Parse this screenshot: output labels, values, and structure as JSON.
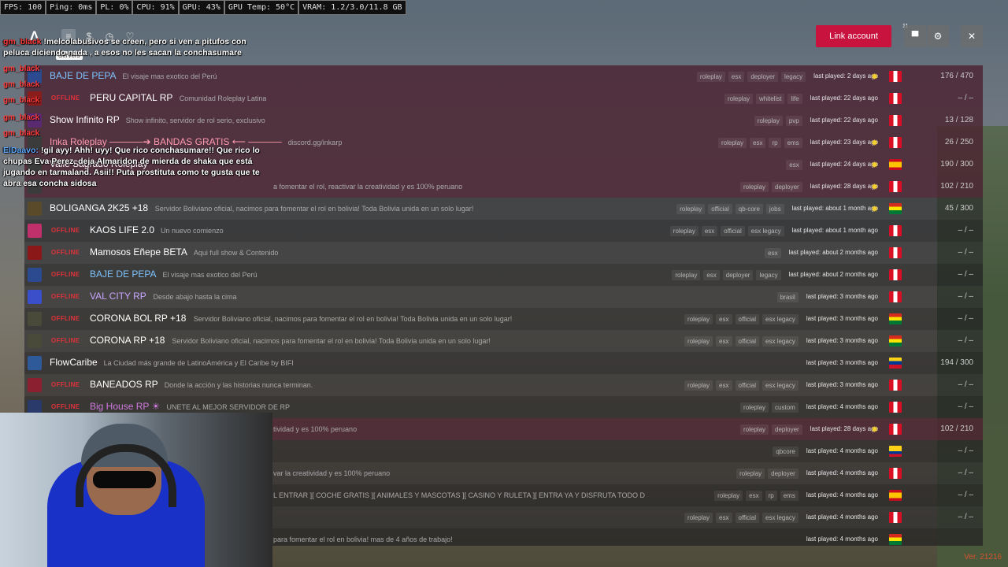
{
  "perf": [
    "FPS: 100",
    "Ping: 0ms",
    "PL: 0%",
    "CPU: 91%",
    "GPU: 43%",
    "GPU Temp: 50°C",
    "VRAM: 1.2/3.0/11.8 GB"
  ],
  "topbar": {
    "logo": "Λ",
    "nav_icons": [
      {
        "name": "servers-list-icon",
        "glyph": "≡",
        "active": true
      },
      {
        "name": "dollar-icon",
        "glyph": "$",
        "active": false
      },
      {
        "name": "history-icon",
        "glyph": "◷",
        "active": false
      },
      {
        "name": "favorites-heart-icon",
        "glyph": "♡",
        "active": false
      }
    ],
    "tooltip": "Servers",
    "link_account": "Link account",
    "badge_count": "11",
    "close_glyph": "✕",
    "settings_glyph": "⚙",
    "tools_glyph": "▀"
  },
  "servers": [
    {
      "icon_color": "#2b4a8f",
      "offline": "",
      "name": "BAJE DE PEPA",
      "name_color": "#7ec3ff",
      "desc": "El visaje mas exotico del Perú",
      "tags": [
        "roleplay",
        "esx",
        "deployer",
        "legacy"
      ],
      "last": "last played: 2 days ago",
      "sun": true,
      "flag": "pe",
      "players": "176 / 470",
      "pinned": true
    },
    {
      "icon_color": "#8a1c1c",
      "offline": "OFFLINE",
      "name": "PERU CAPITAL RP",
      "name_color": "#ffffff",
      "desc": "Comunidad Roleplay Latina",
      "tags": [
        "roleplay",
        "whitelist",
        "life"
      ],
      "last": "last played: 22 days ago",
      "sun": false,
      "flag": "pe",
      "players": "– / –",
      "pinned": true
    },
    {
      "icon_color": "#5a2a70",
      "offline": "",
      "name": "Show Infinito RP",
      "name_color": "#ffffff",
      "desc": "Show infinito, servidor de rol serio, exclusivo",
      "tags": [
        "roleplay",
        "pvp"
      ],
      "last": "last played: 22 days ago",
      "sun": false,
      "flag": "pe",
      "players": "13 / 128",
      "pinned": true
    },
    {
      "icon_color": "#3b3b3b",
      "offline": "",
      "name": "Inka Roleplay ─────➔ BANDAS GRATIS ⟵ ─────",
      "name_color": "#ff9ab0",
      "desc": "discord.gg/inkarp",
      "tags": [
        "roleplay",
        "esx",
        "rp",
        "ems"
      ],
      "last": "last played: 23 days ago",
      "sun": true,
      "flag": "pe",
      "players": "26 / 250",
      "pinned": true
    },
    {
      "icon_color": "#3b3b3b",
      "offline": "",
      "name": "Valle Sagrado Roleplay",
      "name_color": "#ffffff",
      "desc": "",
      "tags": [
        "esx"
      ],
      "last": "last played: 24 days ago",
      "sun": true,
      "flag": "es",
      "players": "190 / 300",
      "pinned": true
    },
    {
      "icon_color": "#3b3b3b",
      "offline": "",
      "name": "",
      "name_color": "#ffffff",
      "desc": "a fomentar el rol, reactivar la creatividad y es 100% peruano",
      "tags": [
        "roleplay",
        "deployer"
      ],
      "last": "last played: 28 days ago",
      "sun": true,
      "flag": "pe",
      "players": "102 / 210",
      "pinned": true
    },
    {
      "icon_color": "#5a4a2a",
      "offline": "",
      "name": "BOLIGANGA 2K25 +18",
      "name_color": "#ffffff",
      "desc": "Servidor Boliviano oficial, nacimos para fomentar el rol en bolivia! Toda Bolivia unida en un solo lugar!",
      "tags": [
        "roleplay",
        "official",
        "qb-core",
        "jobs"
      ],
      "last": "last played: about 1 month ago",
      "sun": true,
      "flag": "bo",
      "players": "45 / 300",
      "pinned": false
    },
    {
      "icon_color": "#c0306a",
      "offline": "OFFLINE",
      "name": "KAOS LIFE 2.0",
      "name_color": "#ffffff",
      "desc": "Un nuevo comienzo",
      "tags": [
        "roleplay",
        "esx",
        "official",
        "esx legacy"
      ],
      "last": "last played: about 1 month ago",
      "sun": false,
      "flag": "pe",
      "players": "– / –",
      "pinned": false
    },
    {
      "icon_color": "#8a1818",
      "offline": "OFFLINE",
      "name": "Mamosos Eñepe BETA",
      "name_color": "#ffffff",
      "desc": "Aqui full show & Contenido",
      "tags": [
        "esx"
      ],
      "last": "last played: about 2 months ago",
      "sun": false,
      "flag": "pe",
      "players": "– / –",
      "pinned": false
    },
    {
      "icon_color": "#2b4a8f",
      "offline": "OFFLINE",
      "name": "BAJE DE PEPA",
      "name_color": "#7ec3ff",
      "desc": "El visaje mas exotico del Perú",
      "tags": [
        "roleplay",
        "esx",
        "deployer",
        "legacy"
      ],
      "last": "last played: about 2 months ago",
      "sun": false,
      "flag": "pe",
      "players": "– / –",
      "pinned": false
    },
    {
      "icon_color": "#3a4fc9",
      "offline": "OFFLINE",
      "name": "VAL CITY RP",
      "name_color": "#c9a6ff",
      "desc": "Desde abajo hasta la cima",
      "tags": [
        "brasil"
      ],
      "last": "last played: 3 months ago",
      "sun": false,
      "flag": "pe",
      "players": "– / –",
      "pinned": false
    },
    {
      "icon_color": "#4a4a3a",
      "offline": "OFFLINE",
      "name": "CORONA BOL RP +18",
      "name_color": "#ffffff",
      "desc": "Servidor Boliviano oficial, nacimos para fomentar el rol en bolivia! Toda Bolivia unida en un solo lugar!",
      "tags": [
        "roleplay",
        "esx",
        "official",
        "esx legacy"
      ],
      "last": "last played: 3 months ago",
      "sun": false,
      "flag": "bo",
      "players": "– / –",
      "pinned": false
    },
    {
      "icon_color": "#4a4a3a",
      "offline": "OFFLINE",
      "name": "CORONA RP +18",
      "name_color": "#ffffff",
      "desc": "Servidor Boliviano oficial, nacimos para fomentar el rol en bolivia! Toda Bolivia unida en un solo lugar!",
      "tags": [
        "roleplay",
        "esx",
        "official",
        "esx legacy"
      ],
      "last": "last played: 3 months ago",
      "sun": false,
      "flag": "bo",
      "players": "– / –",
      "pinned": false
    },
    {
      "icon_color": "#2e5a9a",
      "offline": "",
      "name": "FlowCaribe",
      "name_color": "#ffffff",
      "desc": "La Ciudad más grande de LatinoAmérica y El Caribe by BIFI",
      "tags": [],
      "last": "last played: 3 months ago",
      "sun": false,
      "flag": "ve",
      "players": "194 / 300",
      "pinned": false
    },
    {
      "icon_color": "#8a2030",
      "offline": "OFFLINE",
      "name": "BANEADOS RP",
      "name_color": "#ffffff",
      "desc": "Donde la acción y las historias nunca terminan.",
      "tags": [
        "roleplay",
        "esx",
        "official",
        "esx legacy"
      ],
      "last": "last played: 3 months ago",
      "sun": false,
      "flag": "pe",
      "players": "– / –",
      "pinned": false
    },
    {
      "icon_color": "#2a3a6a",
      "offline": "OFFLINE",
      "name": "Big House RP ☀",
      "name_color": "#d07adf",
      "desc": "UNETE AL MEJOR SERVIDOR DE RP",
      "tags": [
        "roleplay",
        "custom"
      ],
      "last": "last played: 4 months ago",
      "sun": false,
      "flag": "pe",
      "players": "– / –",
      "pinned": false
    },
    {
      "icon_color": "#3b3b3b",
      "offline": "",
      "name": "",
      "name_color": "#ffffff",
      "desc": "tividad y es 100% peruano",
      "tags": [
        "roleplay",
        "deployer"
      ],
      "last": "last played: 28 days ago",
      "sun": true,
      "flag": "pe",
      "players": "102 / 210",
      "pinned": true
    },
    {
      "icon_color": "#3b3b3b",
      "offline": "",
      "name": "",
      "name_color": "#ffffff",
      "desc": "",
      "tags": [
        "qbcore"
      ],
      "last": "last played: 4 months ago",
      "sun": false,
      "flag": "co",
      "players": "– / –",
      "pinned": false
    },
    {
      "icon_color": "#3b3b3b",
      "offline": "",
      "name": "",
      "name_color": "#ffffff",
      "desc": "var la creatividad y es 100% peruano",
      "tags": [
        "roleplay",
        "deployer"
      ],
      "last": "last played: 4 months ago",
      "sun": false,
      "flag": "pe",
      "players": "– / –",
      "pinned": false
    },
    {
      "icon_color": "#3b3b3b",
      "offline": "",
      "name": "",
      "name_color": "#ffffff",
      "desc": "L ENTRAR ][ COCHE GRATIS ][ ANIMALES Y MASCOTAS ][ CASINO Y RULETA ][ ENTRA YA Y DISFRUTA TODO D",
      "tags": [
        "roleplay",
        "esx",
        "rp",
        "ems"
      ],
      "last": "last played: 4 months ago",
      "sun": false,
      "flag": "es",
      "players": "– / –",
      "pinned": false
    },
    {
      "icon_color": "#3b3b3b",
      "offline": "",
      "name": "",
      "name_color": "#ffffff",
      "desc": "",
      "tags": [
        "roleplay",
        "esx",
        "official",
        "esx legacy"
      ],
      "last": "last played: 4 months ago",
      "sun": false,
      "flag": "pe",
      "players": "– / –",
      "pinned": false
    },
    {
      "icon_color": "#3b3b3b",
      "offline": "",
      "name": "",
      "name_color": "#ffffff",
      "desc": "para fomentar el rol en bolivia! mas de 4 años de trabajo!",
      "tags": [],
      "last": "last played: 4 months ago",
      "sun": false,
      "flag": "bo",
      "players": "",
      "pinned": false
    }
  ],
  "chat": {
    "msg1_user": "gm_black",
    "msg1_text": "!melcolabusivos se creen, pero si ven a pitufos con peluca diciendo nada , a esos no les sacan la conchasumare",
    "stack_user": "gm_black",
    "msg2_user": "ElDaavo:",
    "msg2_text": "!gil ayy! Ahh! uyy! Que rico conchasumare!! Que rico lo chupas Eva Perez, deja Almaridon de mierda de shaka que está jugando en tarmaland. Asii!! Puta prostituta como te gusta que te abra esa concha sidosa"
  },
  "version": "Ver. 21216"
}
